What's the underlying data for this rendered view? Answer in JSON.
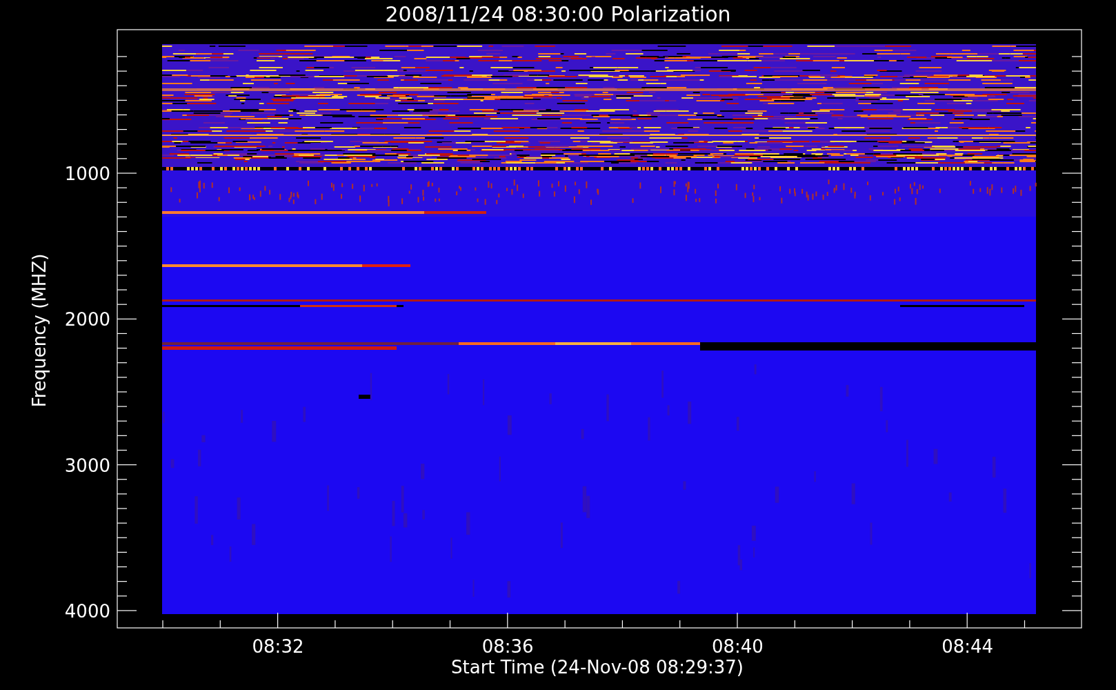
{
  "title": "2008/11/24 08:30:00 Polarization",
  "y_axis": {
    "label": "Frequency (MHZ)",
    "ticks": [
      "1000",
      "2000",
      "3000",
      "4000"
    ]
  },
  "x_axis": {
    "label": "Start Time (24-Nov-08 08:29:37)",
    "ticks": [
      "08:32",
      "08:36",
      "08:40",
      "08:44"
    ]
  }
}
